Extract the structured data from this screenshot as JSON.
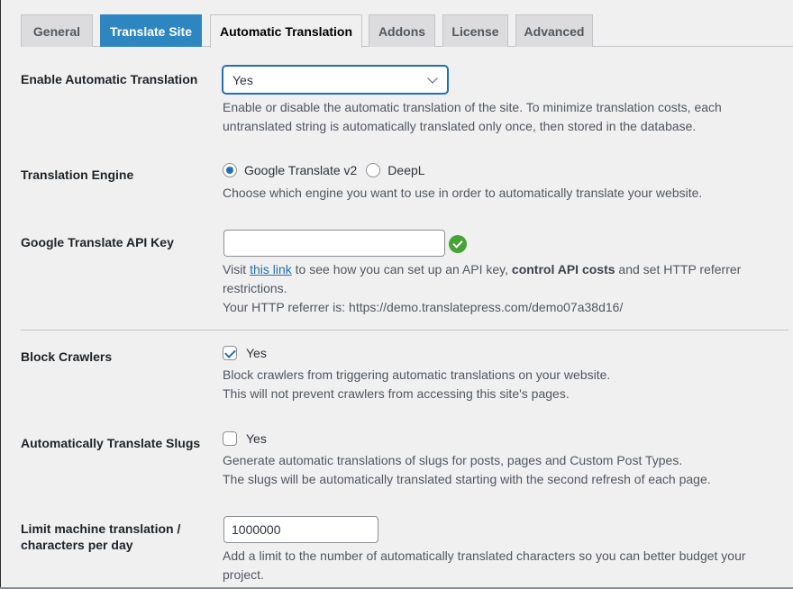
{
  "tabs": [
    {
      "label": "General",
      "state": "inactive"
    },
    {
      "label": "Translate Site",
      "state": "highlight"
    },
    {
      "label": "Automatic Translation",
      "state": "active"
    },
    {
      "label": "Addons",
      "state": "inactive"
    },
    {
      "label": "License",
      "state": "inactive"
    },
    {
      "label": "Advanced",
      "state": "inactive"
    }
  ],
  "enable_auto": {
    "label": "Enable Automatic Translation",
    "value": "Yes",
    "desc_line1": "Enable or disable the automatic translation of the site. To minimize translation costs, each",
    "desc_line2": "untranslated string is automatically translated only once, then stored in the database."
  },
  "engine": {
    "label": "Translation Engine",
    "options": [
      "Google Translate v2",
      "DeepL"
    ],
    "selected": "Google Translate v2",
    "desc": "Choose which engine you want to use in order to automatically translate your website."
  },
  "api_key": {
    "label": "Google Translate API Key",
    "value": "",
    "status_icon": "valid-check-icon",
    "desc_visit": "Visit ",
    "desc_link": "this link",
    "desc_mid": " to see how you can set up an API key, ",
    "desc_bold": "control API costs",
    "desc_end": " and set HTTP referrer",
    "desc_line2": "restrictions.",
    "referrer_line": "Your HTTP referrer is: https://demo.translatepress.com/demo07a38d16/"
  },
  "block_crawlers": {
    "label": "Block Crawlers",
    "checkbox_label": "Yes",
    "checked": true,
    "desc_line1": "Block crawlers from triggering automatic translations on your website.",
    "desc_line2": "This will not prevent crawlers from accessing this site's pages."
  },
  "translate_slugs": {
    "label": "Automatically Translate Slugs",
    "checkbox_label": "Yes",
    "checked": false,
    "desc_line1": "Generate automatic translations of slugs for posts, pages and Custom Post Types.",
    "desc_line2": "The slugs will be automatically translated starting with the second refresh of each page."
  },
  "limit": {
    "label_line1": "Limit machine translation /",
    "label_line2": "characters per day",
    "value": "1000000",
    "desc_line1": "Add a limit to the number of automatically translated characters so you can better budget your",
    "desc_line2": "project."
  }
}
